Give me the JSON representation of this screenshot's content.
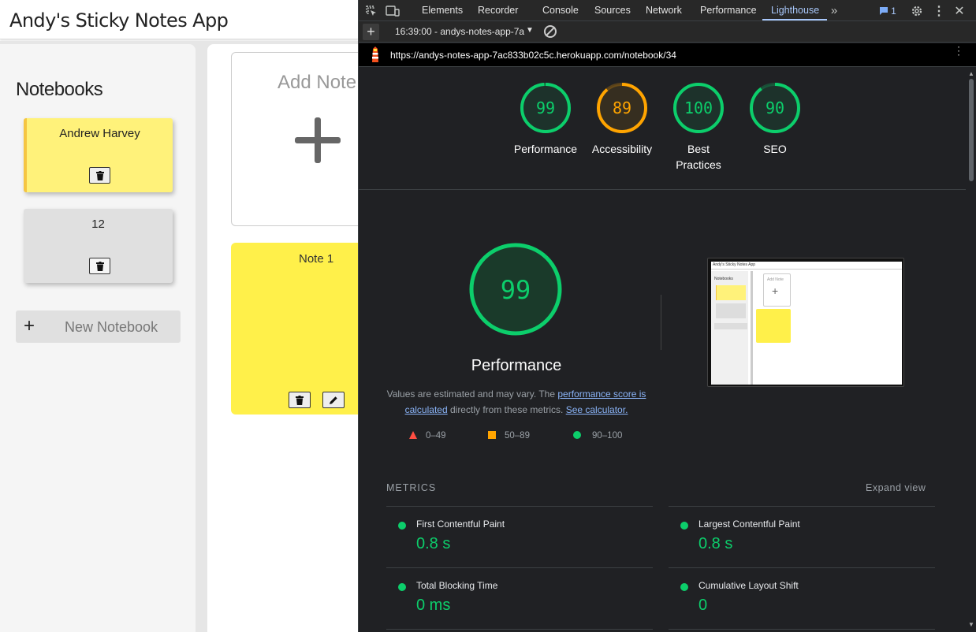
{
  "app": {
    "title": "Andy's Sticky Notes App",
    "sidebar": {
      "heading": "Notebooks",
      "notebooks": [
        {
          "name": "Andrew Harvey",
          "active": true
        },
        {
          "name": "12",
          "active": false
        }
      ],
      "new_notebook_label": "New Notebook"
    },
    "main": {
      "add_note_label": "Add Note",
      "notes": [
        {
          "title": "Note 1"
        }
      ]
    }
  },
  "devtools": {
    "tabs": [
      "Elements",
      "Recorder",
      "Console",
      "Sources",
      "Network",
      "Performance",
      "Lighthouse"
    ],
    "active_tab": "Lighthouse",
    "issues_count": "1",
    "toolbar": {
      "report": "16:39:00 - andys-notes-app-7a"
    },
    "url": "https://andys-notes-app-7ac833b02c5c.herokuapp.com/notebook/34"
  },
  "lighthouse": {
    "scores": [
      {
        "label": "Performance",
        "value": "99",
        "color": "#0cce6b"
      },
      {
        "label": "Accessibility",
        "value": "89",
        "color": "#ffa400"
      },
      {
        "label": "Best Practices",
        "value": "100",
        "color": "#0cce6b"
      },
      {
        "label": "SEO",
        "value": "90",
        "color": "#0cce6b"
      }
    ],
    "main_score": {
      "value": "99",
      "title": "Performance"
    },
    "description": {
      "part1": "Values are estimated and may vary. The ",
      "link1": "performance score is calculated",
      "part2": " directly from these metrics. ",
      "link2": "See calculator."
    },
    "legend": [
      {
        "range": "0–49",
        "color": "#ff4e42",
        "shape": "triangle-icon"
      },
      {
        "range": "50–89",
        "color": "#ffa400",
        "shape": "square-icon"
      },
      {
        "range": "90–100",
        "color": "#0cce6b",
        "shape": "circle-icon"
      }
    ],
    "thumbnail": {
      "title": "Andy's Sticky Notes App",
      "heading": "Notebooks",
      "add_label": "Add Note"
    },
    "metrics_heading": "METRICS",
    "expand_label": "Expand view",
    "metrics": [
      {
        "name": "First Contentful Paint",
        "value": "0.8 s"
      },
      {
        "name": "Largest Contentful Paint",
        "value": "0.8 s"
      },
      {
        "name": "Total Blocking Time",
        "value": "0 ms"
      },
      {
        "name": "Cumulative Layout Shift",
        "value": "0"
      }
    ]
  }
}
